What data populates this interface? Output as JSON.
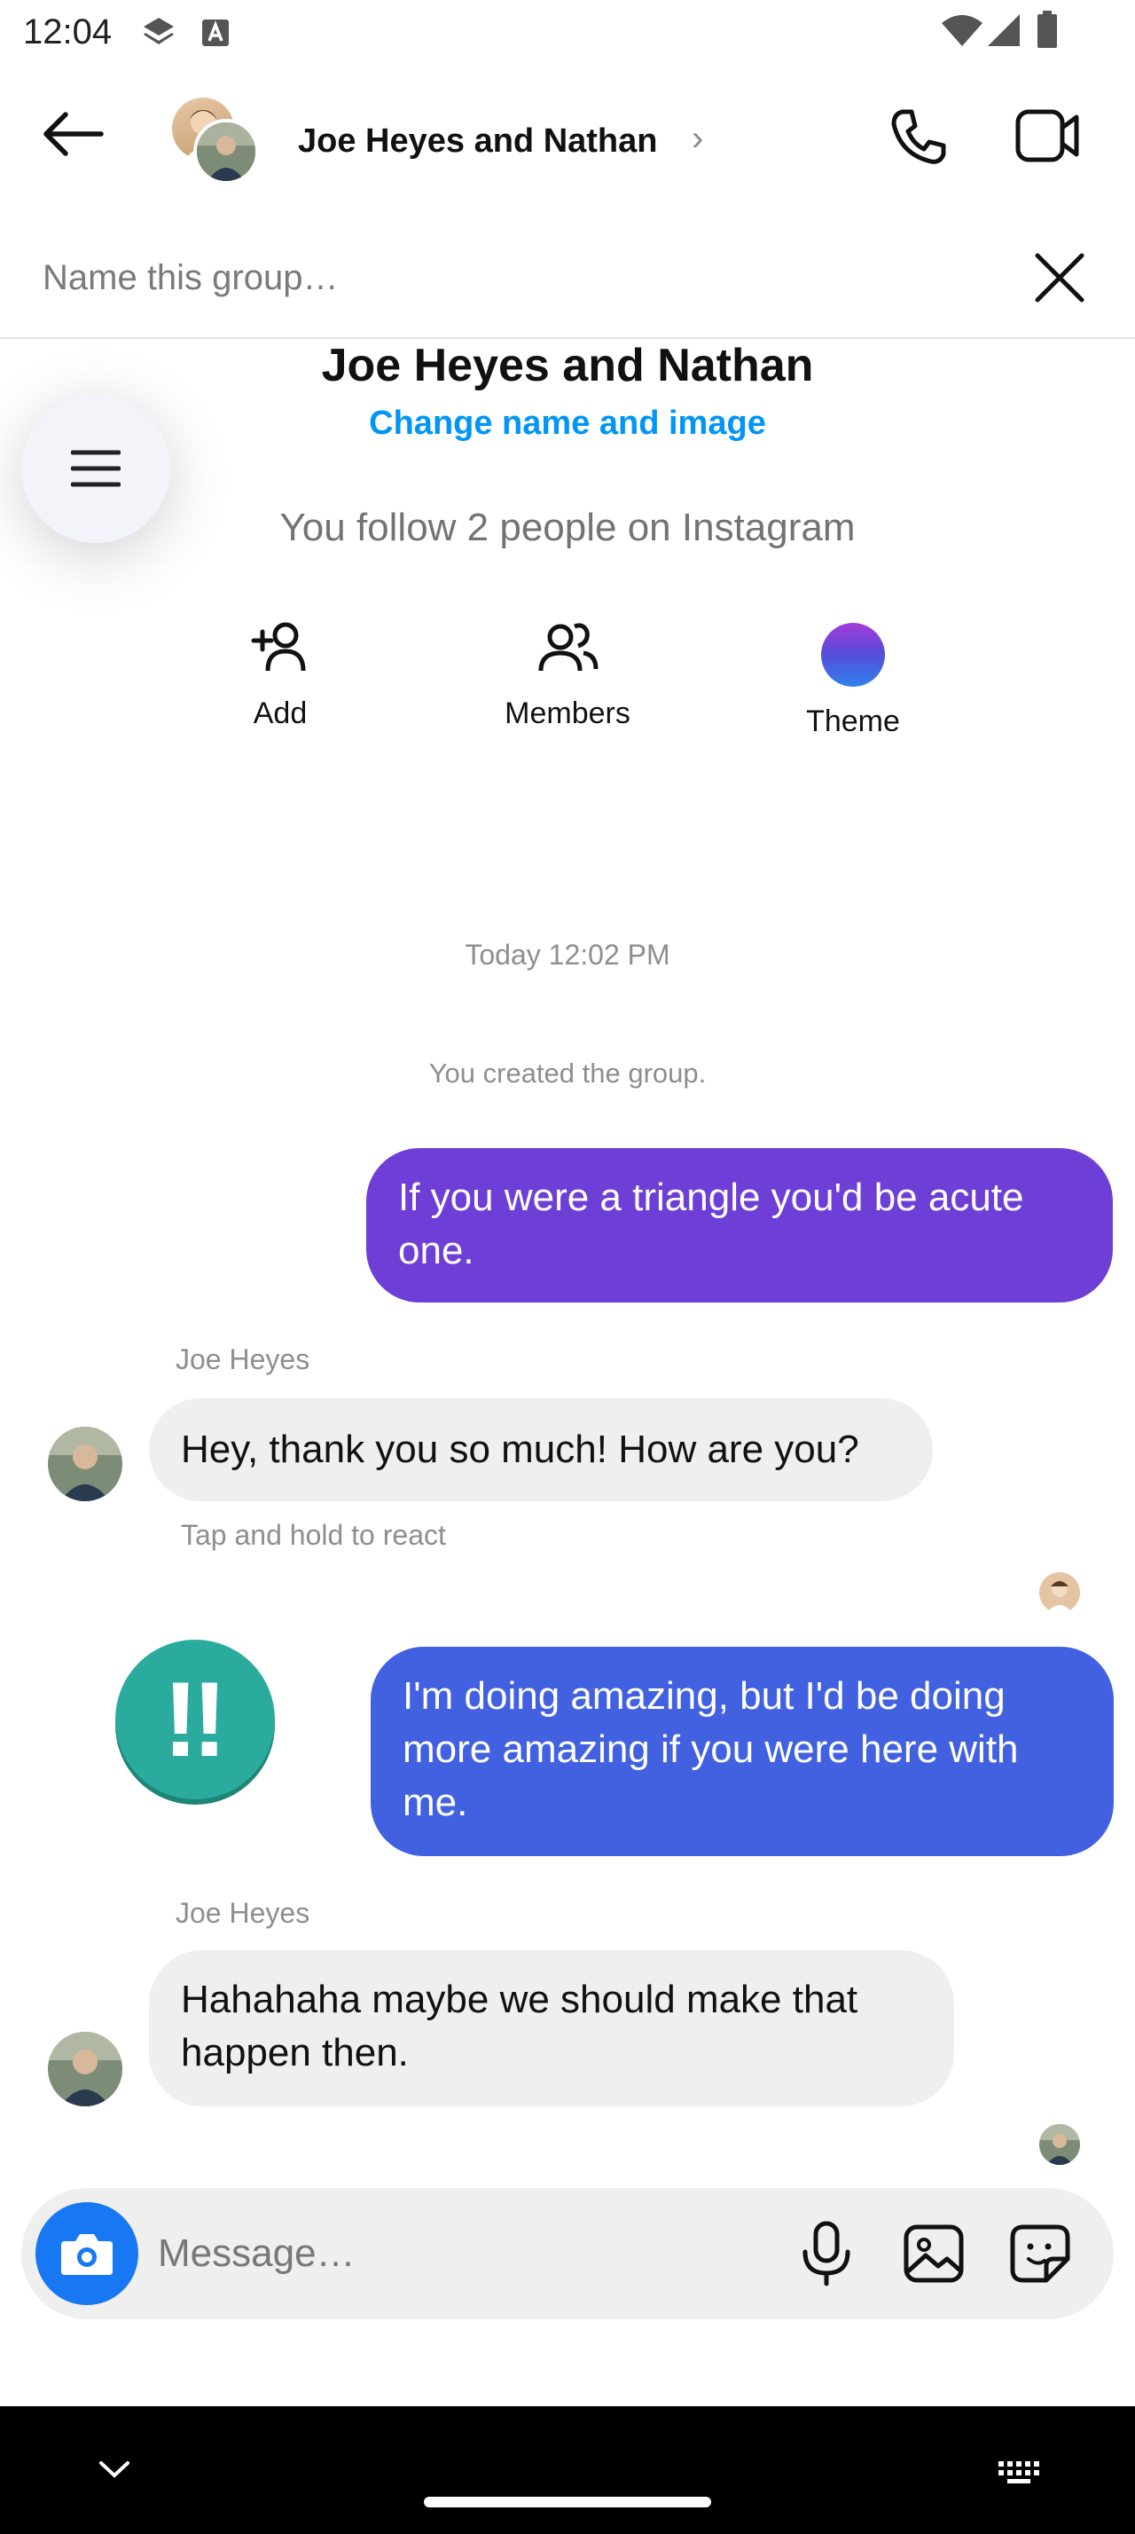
{
  "status_bar": {
    "time": "12:04"
  },
  "header": {
    "title": "Joe Heyes and Nathan",
    "chevron": "›"
  },
  "name_field": {
    "placeholder": "Name this group…",
    "value": ""
  },
  "conversation": {
    "title": "Joe Heyes and Nathan",
    "change_link": "Change name and image",
    "follow_text": "You follow 2 people on Instagram"
  },
  "actions": [
    {
      "label": "Add",
      "icon": "add-person-icon"
    },
    {
      "label": "Members",
      "icon": "members-icon"
    },
    {
      "label": "Theme",
      "icon": "theme-gradient-dot"
    }
  ],
  "thread": {
    "timestamp": "Today 12:02 PM",
    "created_text": "You created the group.",
    "messages": [
      {
        "from": "me",
        "text": "If you were a triangle you'd be acute one.",
        "color": "#6e3fd6"
      },
      {
        "from": "Joe Heyes",
        "sender_label": "Joe Heyes",
        "text": "Hey, thank you so much! How are you?",
        "hint": "Tap and hold to react"
      },
      {
        "from": "me",
        "text": "I'm doing amazing, but I'd be doing more amazing if you were here with me.",
        "color": "#4161e0",
        "reaction": "‼"
      },
      {
        "from": "Joe Heyes",
        "sender_label": "Joe Heyes",
        "text": "Hahahaha maybe we should make that happen then."
      }
    ]
  },
  "composer": {
    "placeholder": "Message…",
    "value": ""
  },
  "colors": {
    "accent_link": "#0095f6",
    "camera_button": "#1877f2",
    "reaction_bg": "#2aab9d"
  }
}
